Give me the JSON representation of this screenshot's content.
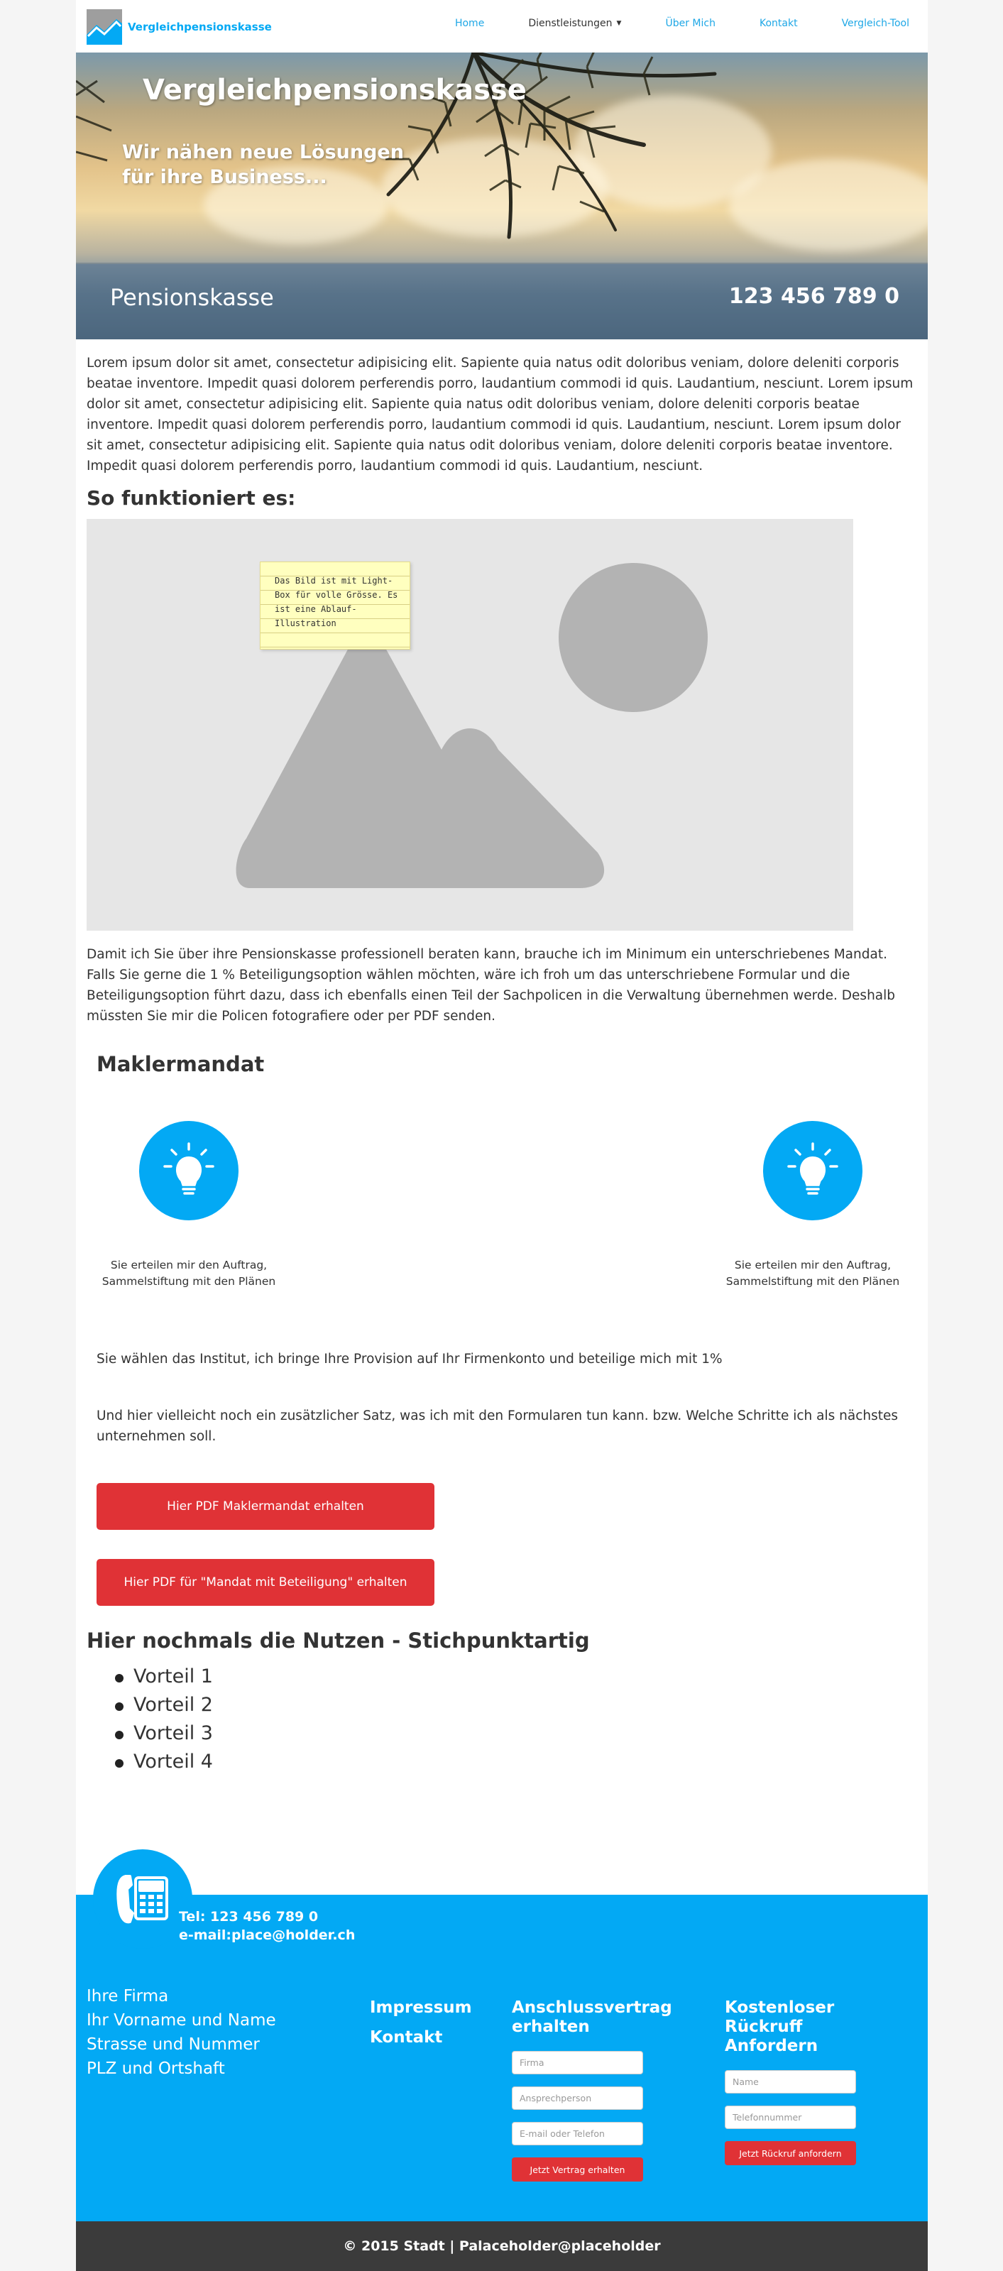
{
  "nav": {
    "brand": "Vergleichpensionskasse",
    "items": [
      {
        "label": "Home"
      },
      {
        "label": "Dienstleistungen"
      },
      {
        "label": "Über Mich"
      },
      {
        "label": "Kontakt"
      },
      {
        "label": "Vergleich-Tool"
      }
    ]
  },
  "hero": {
    "title": "Vergleichpensionskasse",
    "subtitle": "Wir nähen neue Lösungen für ihre Business...",
    "bar_left": "Pensionskasse",
    "bar_right": "123 456 789 0"
  },
  "content": {
    "intro": "Lorem ipsum dolor sit amet, consectetur adipisicing elit. Sapiente quia natus odit doloribus veniam, dolore deleniti corporis beatae inventore. Impedit quasi dolorem perferendis porro, laudantium commodi id quis. Laudantium, nesciunt. Lorem ipsum dolor sit amet, consectetur adipisicing elit. Sapiente quia natus odit doloribus veniam, dolore deleniti corporis beatae inventore. Impedit quasi dolorem perferendis porro, laudantium commodi id quis. Laudantium, nesciunt. Lorem ipsum dolor sit amet, consectetur adipisicing elit. Sapiente quia natus odit doloribus veniam, dolore deleniti corporis beatae inventore. Impedit quasi dolorem perferendis porro, laudantium commodi id quis. Laudantium, nesciunt.",
    "how_heading": "So funktioniert es:",
    "note": "Das Bild ist mit Light-Box für volle Grösse. Es ist eine Ablauf-Illustration",
    "para2": "Damit ich Sie über ihre Pensionskasse professionell beraten kann, brauche ich im Minimum ein unterschriebenes Mandat. Falls Sie gerne die 1 % Beteiligungsoption wählen möchten, wäre ich froh um das unterschriebene Formular und die Beteiligungsoption führt dazu, dass ich ebenfalls einen Teil der Sachpolicen in die Verwaltung übernehmen werde. Deshalb müssten Sie mir die Policen fotografiere oder per PDF senden.",
    "mandat_heading": "Maklermandat",
    "steps": [
      {
        "caption": "Sie erteilen mir den Auftrag, Sammelstiftung mit den Plänen",
        "icon": "lightbulb-icon"
      },
      {
        "caption": "Sie erteilen mir den Auftrag, Sammelstiftung mit den Plänen",
        "icon": "lightbulb-icon"
      }
    ],
    "institut": "Sie wählen das Institut, ich bringe Ihre Provision auf Ihr Firmenkonto und beteilige mich mit 1%",
    "satz": "Und hier vielleicht noch ein zusätzlicher Satz, was ich mit den Formularen tun kann. bzw. Welche Schritte ich als nächstes unternehmen soll.",
    "btn_mandat": "Hier PDF Maklermandat erhalten",
    "btn_beteiligung": "Hier PDF für \"Mandat mit Beteiligung\" erhalten",
    "nutzen_heading": "Hier nochmals die Nutzen - Stichpunktartig",
    "vorteile": [
      "Vorteil 1",
      "Vorteil 2",
      "Vorteil 3",
      "Vorteil 4"
    ]
  },
  "footer": {
    "tel": "Tel: 123 456 789 0",
    "email": "e-mail:place@holder.ch",
    "address": [
      "Ihre Firma",
      "Ihr Vorname und Name",
      "Strasse und Nummer",
      "PLZ und Ortshaft"
    ],
    "links": [
      "Impressum",
      "Kontakt"
    ],
    "vertrag": {
      "heading": "Anschlussvertrag erhalten",
      "placeholders": [
        "Firma",
        "Ansprechperson",
        "E-mail oder Telefon"
      ],
      "button": "Jetzt Vertrag erhalten"
    },
    "rueckruf": {
      "heading": "Kostenloser Rückruff Anfordern",
      "placeholders": [
        "Name",
        "Telefonnummer"
      ],
      "button": "Jetzt Rückruf anfordern"
    },
    "copyright": "© 2015 Stadt | Palaceholder@placeholder"
  },
  "colors": {
    "accent": "#03a9f4",
    "button": "#e03236",
    "footer_bottom": "#3b3b3b"
  }
}
